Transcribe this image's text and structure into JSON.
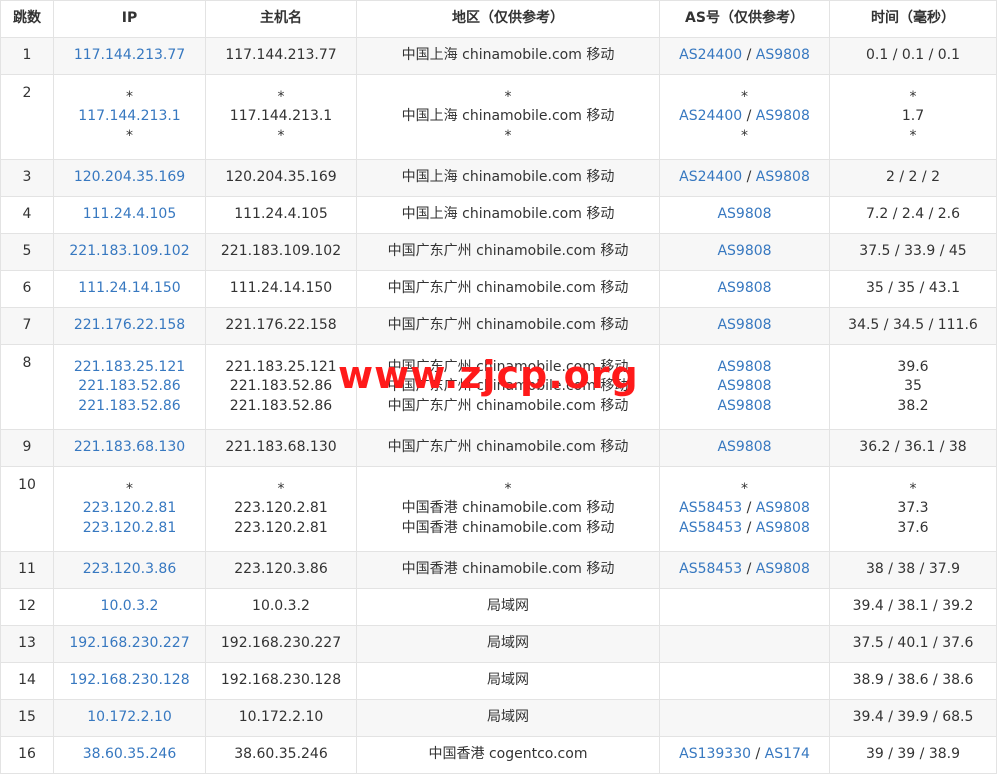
{
  "headers": [
    "跳数",
    "IP",
    "主机名",
    "地区（仅供参考）",
    "AS号（仅供参考）",
    "时间（毫秒）"
  ],
  "rows": [
    {
      "hop": "1",
      "ip": [
        "117.144.213.77"
      ],
      "host": [
        "117.144.213.77"
      ],
      "region": [
        "中国上海 chinamobile.com 移动"
      ],
      "as": [
        [
          "AS24400",
          "AS9808"
        ]
      ],
      "time": [
        "0.1 / 0.1 / 0.1"
      ]
    },
    {
      "hop": "2",
      "ip": [
        "*",
        "117.144.213.1",
        "*"
      ],
      "host": [
        "*",
        "117.144.213.1",
        "*"
      ],
      "region": [
        "*",
        "中国上海 chinamobile.com 移动",
        "*"
      ],
      "as": [
        [
          "*"
        ],
        [
          "AS24400",
          "AS9808"
        ],
        [
          "*"
        ]
      ],
      "time": [
        "*",
        "1.7",
        "*"
      ]
    },
    {
      "hop": "3",
      "ip": [
        "120.204.35.169"
      ],
      "host": [
        "120.204.35.169"
      ],
      "region": [
        "中国上海 chinamobile.com 移动"
      ],
      "as": [
        [
          "AS24400",
          "AS9808"
        ]
      ],
      "time": [
        "2 / 2 / 2"
      ]
    },
    {
      "hop": "4",
      "ip": [
        "111.24.4.105"
      ],
      "host": [
        "111.24.4.105"
      ],
      "region": [
        "中国上海 chinamobile.com 移动"
      ],
      "as": [
        [
          "AS9808"
        ]
      ],
      "time": [
        "7.2 / 2.4 / 2.6"
      ]
    },
    {
      "hop": "5",
      "ip": [
        "221.183.109.102"
      ],
      "host": [
        "221.183.109.102"
      ],
      "region": [
        "中国广东广州 chinamobile.com 移动"
      ],
      "as": [
        [
          "AS9808"
        ]
      ],
      "time": [
        "37.5 / 33.9 / 45"
      ]
    },
    {
      "hop": "6",
      "ip": [
        "111.24.14.150"
      ],
      "host": [
        "111.24.14.150"
      ],
      "region": [
        "中国广东广州 chinamobile.com 移动"
      ],
      "as": [
        [
          "AS9808"
        ]
      ],
      "time": [
        "35 / 35 / 43.1"
      ]
    },
    {
      "hop": "7",
      "ip": [
        "221.176.22.158"
      ],
      "host": [
        "221.176.22.158"
      ],
      "region": [
        "中国广东广州 chinamobile.com 移动"
      ],
      "as": [
        [
          "AS9808"
        ]
      ],
      "time": [
        "34.5 / 34.5 / 111.6"
      ]
    },
    {
      "hop": "8",
      "ip": [
        "221.183.25.121",
        "221.183.52.86",
        "221.183.52.86"
      ],
      "host": [
        "221.183.25.121",
        "221.183.52.86",
        "221.183.52.86"
      ],
      "region": [
        "中国广东广州 chinamobile.com 移动",
        "中国广东广州 chinamobile.com 移动",
        "中国广东广州 chinamobile.com 移动"
      ],
      "as": [
        [
          "AS9808"
        ],
        [
          "AS9808"
        ],
        [
          "AS9808"
        ]
      ],
      "time": [
        "39.6",
        "35",
        "38.2"
      ]
    },
    {
      "hop": "9",
      "ip": [
        "221.183.68.130"
      ],
      "host": [
        "221.183.68.130"
      ],
      "region": [
        "中国广东广州 chinamobile.com 移动"
      ],
      "as": [
        [
          "AS9808"
        ]
      ],
      "time": [
        "36.2 / 36.1 / 38"
      ]
    },
    {
      "hop": "10",
      "ip": [
        "*",
        "223.120.2.81",
        "223.120.2.81"
      ],
      "host": [
        "*",
        "223.120.2.81",
        "223.120.2.81"
      ],
      "region": [
        "*",
        "中国香港 chinamobile.com 移动",
        "中国香港 chinamobile.com 移动"
      ],
      "as": [
        [
          "*"
        ],
        [
          "AS58453",
          "AS9808"
        ],
        [
          "AS58453",
          "AS9808"
        ]
      ],
      "time": [
        "*",
        "37.3",
        "37.6"
      ]
    },
    {
      "hop": "11",
      "ip": [
        "223.120.3.86"
      ],
      "host": [
        "223.120.3.86"
      ],
      "region": [
        "中国香港 chinamobile.com 移动"
      ],
      "as": [
        [
          "AS58453",
          "AS9808"
        ]
      ],
      "time": [
        "38 / 38 / 37.9"
      ]
    },
    {
      "hop": "12",
      "ip": [
        "10.0.3.2"
      ],
      "host": [
        "10.0.3.2"
      ],
      "region": [
        "局域网"
      ],
      "as": [
        []
      ],
      "time": [
        "39.4 / 38.1 / 39.2"
      ]
    },
    {
      "hop": "13",
      "ip": [
        "192.168.230.227"
      ],
      "host": [
        "192.168.230.227"
      ],
      "region": [
        "局域网"
      ],
      "as": [
        []
      ],
      "time": [
        "37.5 / 40.1 / 37.6"
      ]
    },
    {
      "hop": "14",
      "ip": [
        "192.168.230.128"
      ],
      "host": [
        "192.168.230.128"
      ],
      "region": [
        "局域网"
      ],
      "as": [
        []
      ],
      "time": [
        "38.9 / 38.6 / 38.6"
      ]
    },
    {
      "hop": "15",
      "ip": [
        "10.172.2.10"
      ],
      "host": [
        "10.172.2.10"
      ],
      "region": [
        "局域网"
      ],
      "as": [
        []
      ],
      "time": [
        "39.4 / 39.9 / 68.5"
      ]
    },
    {
      "hop": "16",
      "ip": [
        "38.60.35.246"
      ],
      "host": [
        "38.60.35.246"
      ],
      "region": [
        "中国香港 cogentco.com"
      ],
      "as": [
        [
          "AS139330",
          "AS174"
        ]
      ],
      "time": [
        "39 / 39 / 38.9"
      ]
    }
  ],
  "watermark": "www.zjcp.org",
  "colors": {
    "link": "#3778c0",
    "watermark": "#ff1a1a",
    "row_alt": "#f7f7f7",
    "border": "#e3e3e3"
  }
}
